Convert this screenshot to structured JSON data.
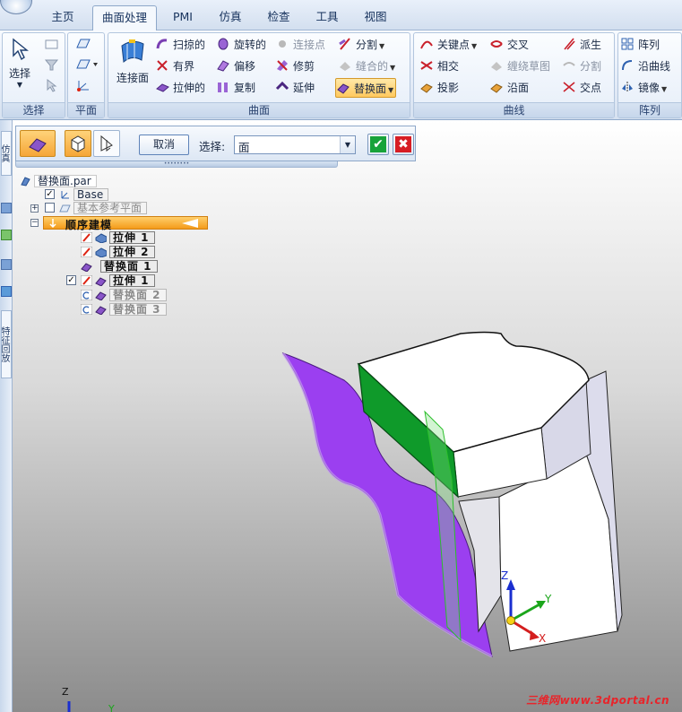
{
  "tabs": [
    "主页",
    "曲面处理",
    "PMI",
    "仿真",
    "检查",
    "工具",
    "视图"
  ],
  "active_tab": "曲面处理",
  "ribbon": {
    "select_group": {
      "big_label": "选择",
      "group_label": "选择"
    },
    "plane_group": {
      "group_label": "平面"
    },
    "surface_group": {
      "group_label": "曲面",
      "big_label": "连接面",
      "col1": [
        "扫掠的",
        "有界",
        "拉伸的"
      ],
      "col2": [
        "旋转的",
        "偏移",
        "复制"
      ],
      "col3": [
        "连接点",
        "修剪",
        "延伸"
      ],
      "col4": [
        "分割",
        "缝合的",
        "替换面"
      ]
    },
    "curve_group": {
      "group_label": "曲线",
      "col1": [
        "关键点",
        "相交",
        "投影"
      ],
      "col2": [
        "交叉",
        "缠绕草图",
        "沿面"
      ],
      "col3": [
        "派生",
        "分割",
        "交点"
      ]
    },
    "pattern_group": {
      "group_label": "阵列",
      "items": [
        "阵列",
        "沿曲线",
        "镜像"
      ]
    }
  },
  "left_tabs": [
    "仿真",
    "特征回放"
  ],
  "command_bar": {
    "cancel_label": "取消",
    "select_label": "选择:",
    "select_value": "面",
    "ok_symbol": "✔",
    "cancel_symbol": "✖"
  },
  "tree": {
    "file": "替换面.par",
    "base": "Base",
    "ref_planes": "基本参考平面",
    "ordered": "顺序建模",
    "features": [
      "拉伸 1",
      "拉伸 2",
      "替换面 1",
      "拉伸 1",
      "替换面 2",
      "替换面 3"
    ]
  },
  "axes": {
    "z": "Z",
    "y": "Y",
    "x": "X"
  },
  "watermark": "三维网www.3dportal.cn",
  "colors": {
    "surface_purple": "#9b3ff0",
    "selected_face_green": "#0f9a2a",
    "ordered_orange": "#f5a11f",
    "ribbon_blue": "#d6e1f0"
  }
}
